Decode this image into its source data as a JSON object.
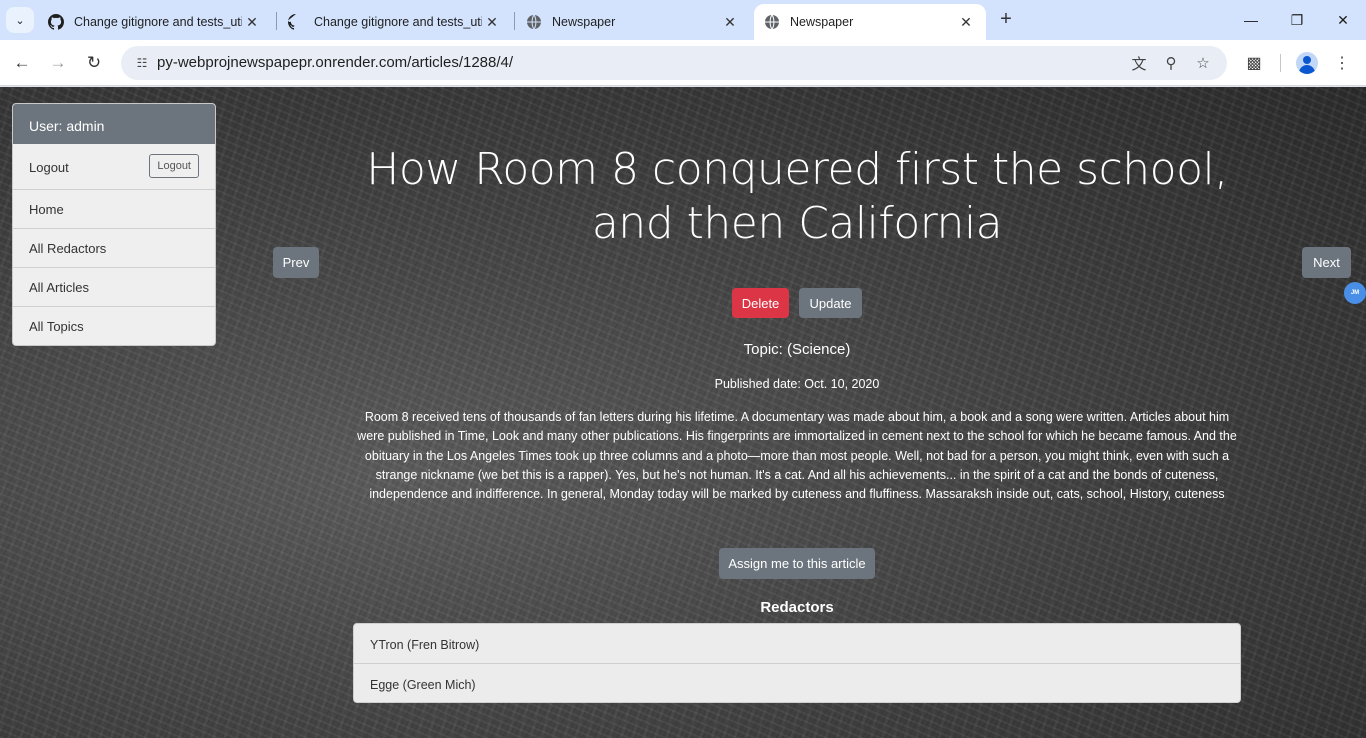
{
  "browser": {
    "tabs": [
      {
        "title": "Change gitignore and tests_util",
        "icon": "github-icon"
      },
      {
        "title": "Change gitignore and tests_util",
        "icon": "github-icon"
      },
      {
        "title": "Newspaper",
        "icon": "globe-icon"
      },
      {
        "title": "Newspaper",
        "icon": "globe-icon",
        "active": true
      }
    ],
    "url": "py-webprojnewspapepr.onrender.com/articles/1288/4/"
  },
  "sidebar": {
    "user_label": "User: admin",
    "logout_label": "Logout",
    "logout_button": "Logout",
    "items": [
      "Home",
      "All Redactors",
      "All Articles",
      "All Topics"
    ]
  },
  "nav": {
    "prev": "Prev",
    "next": "Next"
  },
  "article": {
    "title": "How Room 8 conquered first the school, and then California",
    "delete_label": "Delete",
    "update_label": "Update",
    "topic": "Topic: (Science)",
    "published": "Published date: Oct. 10, 2020",
    "content": "Room 8 received tens of thousands of fan letters during his lifetime. A documentary was made about him, a book and a song were written. Articles about him were published in Time, Look and many other publications. His fingerprints are immortalized in cement next to the school for which he became famous. And the obituary in the Los Angeles Times took up three columns and a photo—more than most people. Well, not bad for a person, you might think, even with such a strange nickname (we bet this is a rapper). Yes, but he's not human. It's a cat. And all his achievements... in the spirit of a cat and the bonds of cuteness, independence and indifference. In general, Monday today will be marked by cuteness and fluffiness. Massaraksh inside out, cats, school, History, cuteness",
    "assign_label": "Assign me to this article",
    "redactors_title": "Redactors",
    "redactors": [
      "YTron (Fren Bitrow)",
      "Egge (Green Mich)"
    ]
  },
  "colors": {
    "danger": "#dc3545",
    "secondary": "#6c757d",
    "chrome": "#d3e3fd"
  }
}
